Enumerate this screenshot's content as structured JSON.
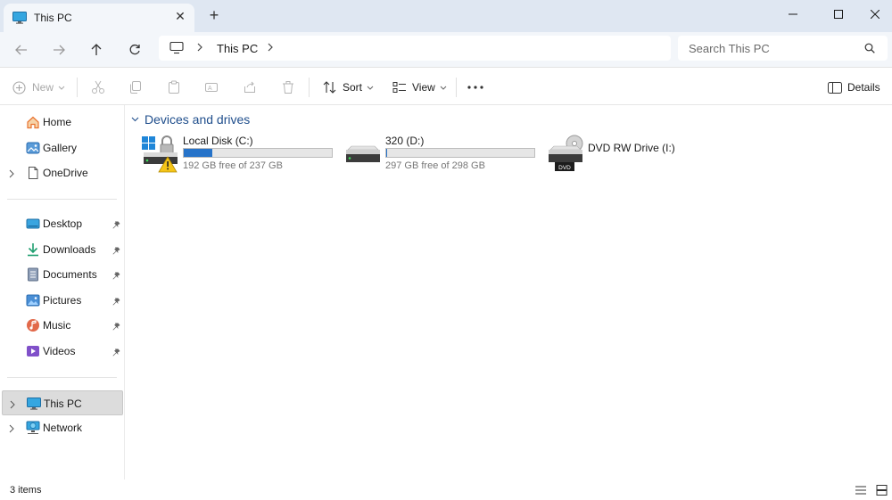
{
  "window": {
    "tab_title": "This PC",
    "tab_icon": "pc-monitor-icon",
    "controls": [
      "minimize-icon",
      "maximize-icon",
      "close-icon"
    ]
  },
  "address": {
    "breadcrumb": [
      "This PC"
    ],
    "search_placeholder": "Search This PC"
  },
  "toolbar": {
    "new_label": "New",
    "sort_label": "Sort",
    "view_label": "View",
    "details_label": "Details",
    "disabled_icons": [
      "cut-icon",
      "copy-icon",
      "paste-icon",
      "rename-icon",
      "share-icon",
      "delete-icon"
    ]
  },
  "sidebar": {
    "top_items": [
      {
        "label": "Home",
        "icon": "home-icon"
      },
      {
        "label": "Gallery",
        "icon": "gallery-icon"
      },
      {
        "label": "OneDrive",
        "icon": "document-outline-icon"
      }
    ],
    "quick_access": [
      {
        "label": "Desktop",
        "icon": "desktop-folder-icon"
      },
      {
        "label": "Downloads",
        "icon": "download-arrow-icon"
      },
      {
        "label": "Documents",
        "icon": "documents-icon"
      },
      {
        "label": "Pictures",
        "icon": "pictures-icon"
      },
      {
        "label": "Music",
        "icon": "music-icon"
      },
      {
        "label": "Videos",
        "icon": "videos-icon"
      }
    ],
    "bottom_items": [
      {
        "label": "This PC",
        "icon": "pc-monitor-icon",
        "selected": true
      },
      {
        "label": "Network",
        "icon": "network-icon"
      }
    ]
  },
  "main": {
    "group_title": "Devices and drives",
    "drives": [
      {
        "name": "Local Disk (C:)",
        "free_text": "192 GB free of 237 GB",
        "used_fraction": 0.19,
        "icon": "system-drive-warning-icon"
      },
      {
        "name": "320 (D:)",
        "free_text": "297 GB free of 298 GB",
        "used_fraction": 0.003,
        "icon": "hard-drive-icon"
      },
      {
        "name": "DVD RW Drive (I:)",
        "icon": "dvd-drive-icon",
        "badge": "DVD"
      }
    ]
  },
  "status": {
    "item_count": "3 items"
  },
  "colors": {
    "titlebar_bg": "#dfe7f2",
    "accent": "#2673c9",
    "group_header": "#1f4e8c"
  }
}
